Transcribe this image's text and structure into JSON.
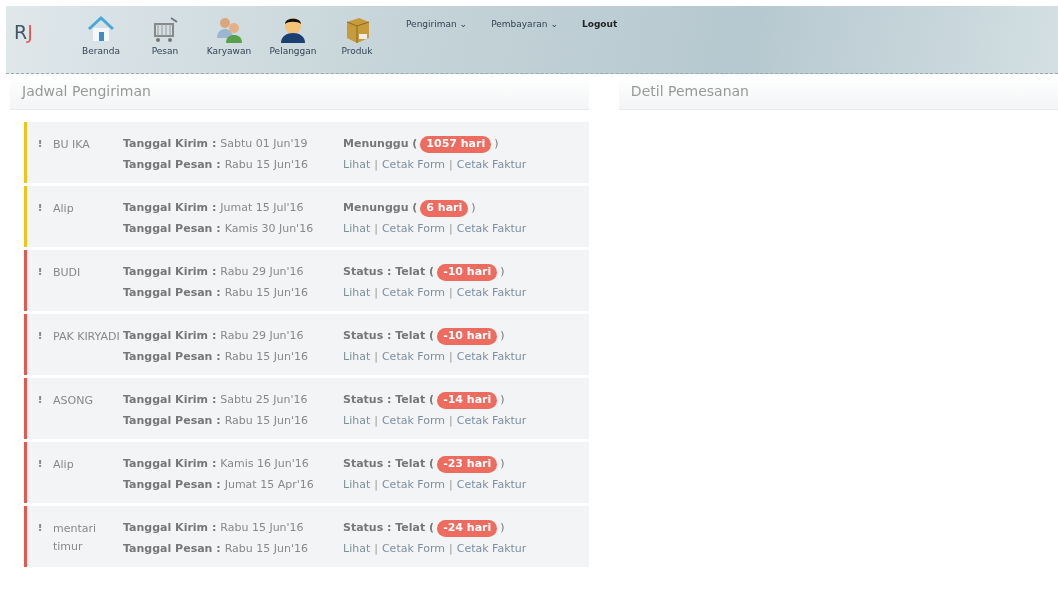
{
  "brand": {
    "letter_1": "R",
    "letter_2": "J"
  },
  "nav_icons": [
    {
      "label": "Beranda",
      "kind": "house"
    },
    {
      "label": "Pesan",
      "kind": "cart"
    },
    {
      "label": "Karyawan",
      "kind": "people"
    },
    {
      "label": "Pelanggan",
      "kind": "person"
    },
    {
      "label": "Produk",
      "kind": "box"
    }
  ],
  "nav_menus": [
    {
      "label": "Pengiriman",
      "caret": "⌄",
      "kind": "dropdown"
    },
    {
      "label": "Pembayaran",
      "caret": "⌄",
      "kind": "dropdown"
    },
    {
      "label": "Logout",
      "kind": "link"
    }
  ],
  "left_panel": {
    "title": "Jadwal Pengiriman"
  },
  "right_panel": {
    "title": "Detil Pemesanan"
  },
  "schedules": [
    {
      "color": "#f0c419",
      "handle": "⁝",
      "name": "BU IKA",
      "kirim_label": "Tanggal Kirim :",
      "kirim": "Sabtu 01 Jun'19",
      "pesan_label": "Tanggal Pesan :",
      "pesan": "Rabu 15 Jun'16",
      "status": "Menunggu (",
      "days": "1057 hari",
      "close": ")",
      "links": [
        "Lihat",
        "Cetak Form",
        "Cetak Faktur"
      ],
      "separators": [
        "|",
        "|"
      ]
    },
    {
      "color": "#f0c419",
      "handle": "⁝",
      "name": "Alip",
      "kirim_label": "Tanggal Kirim :",
      "kirim": "Jumat 15 Jul'16",
      "pesan_label": "Tanggal Pesan :",
      "pesan": "Kamis 30 Jun'16",
      "status": "Menunggu (",
      "days": "6 hari",
      "close": ")",
      "links": [
        "Lihat",
        "Cetak Form",
        "Cetak Faktur"
      ],
      "separators": [
        "|",
        "|"
      ]
    },
    {
      "color": "#e8574b",
      "handle": "⁝",
      "name": "BUDI",
      "kirim_label": "Tanggal Kirim :",
      "kirim": "Rabu 29 Jun'16",
      "pesan_label": "Tanggal Pesan :",
      "pesan": "Rabu 15 Jun'16",
      "status": "Status : Telat (",
      "days": "-10 hari",
      "close": ")",
      "links": [
        "Lihat",
        "Cetak Form",
        "Cetak Faktur"
      ],
      "separators": [
        "|",
        "|"
      ]
    },
    {
      "color": "#e8574b",
      "handle": "⁝",
      "name": "PAK KIRYADI",
      "kirim_label": "Tanggal Kirim :",
      "kirim": "Rabu 29 Jun'16",
      "pesan_label": "Tanggal Pesan :",
      "pesan": "Rabu 15 Jun'16",
      "status": "Status : Telat (",
      "days": "-10 hari",
      "close": ")",
      "links": [
        "Lihat",
        "Cetak Form",
        "Cetak Faktur"
      ],
      "separators": [
        "|",
        "|"
      ]
    },
    {
      "color": "#e8574b",
      "handle": "⁝",
      "name": "ASONG",
      "kirim_label": "Tanggal Kirim :",
      "kirim": "Sabtu 25 Jun'16",
      "pesan_label": "Tanggal Pesan :",
      "pesan": "Rabu 15 Jun'16",
      "status": "Status : Telat (",
      "days": "-14 hari",
      "close": ")",
      "links": [
        "Lihat",
        "Cetak Form",
        "Cetak Faktur"
      ],
      "separators": [
        "|",
        "|"
      ]
    },
    {
      "color": "#e8574b",
      "handle": "⁝",
      "name": "Alip",
      "kirim_label": "Tanggal Kirim :",
      "kirim": "Kamis 16 Jun'16",
      "pesan_label": "Tanggal Pesan :",
      "pesan": "Jumat 15 Apr'16",
      "status": "Status : Telat (",
      "days": "-23 hari",
      "close": ")",
      "links": [
        "Lihat",
        "Cetak Form",
        "Cetak Faktur"
      ],
      "separators": [
        "|",
        "|"
      ]
    },
    {
      "color": "#e8574b",
      "handle": "⁝",
      "name": "mentari timur",
      "kirim_label": "Tanggal Kirim :",
      "kirim": "Rabu 15 Jun'16",
      "pesan_label": "Tanggal Pesan :",
      "pesan": "Rabu 15 Jun'16",
      "status": "Status : Telat (",
      "days": "-24 hari",
      "close": ")",
      "links": [
        "Lihat",
        "Cetak Form",
        "Cetak Faktur"
      ],
      "separators": [
        "|",
        "|"
      ]
    }
  ]
}
